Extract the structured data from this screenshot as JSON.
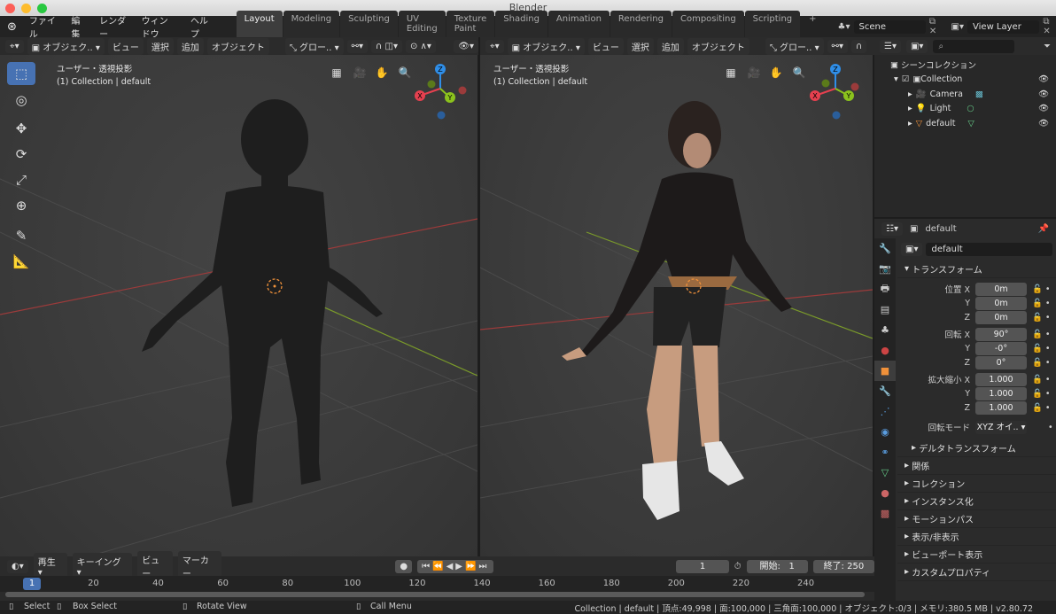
{
  "window": {
    "title": "Blender"
  },
  "topbar": {
    "menus": [
      "ファイル",
      "編集",
      "レンダー",
      "ウィンドウ",
      "ヘルプ"
    ],
    "workspaces": [
      "Layout",
      "Modeling",
      "Sculpting",
      "UV Editing",
      "Texture Paint",
      "Shading",
      "Animation",
      "Rendering",
      "Compositing",
      "Scripting"
    ],
    "add_tab": "+",
    "scene": "Scene",
    "view_layer": "View Layer"
  },
  "viewport_header": {
    "mode": "オブジェク..",
    "view": "ビュー",
    "select": "選択",
    "add": "追加",
    "object": "オブジェクト",
    "orientation": "グロー.."
  },
  "viewport_left": {
    "view_name": "ユーザー・透視投影",
    "collection_info": "(1) Collection | default"
  },
  "viewport_right": {
    "view_name": "ユーザー・透視投影",
    "collection_info": "(1) Collection | default"
  },
  "gizmo": {
    "x": "X",
    "y": "Y",
    "z": "Z"
  },
  "outliner": {
    "root": "シーンコレクション",
    "collection": "Collection",
    "items": [
      "Camera",
      "Light",
      "default"
    ]
  },
  "properties": {
    "object_name": "default",
    "data_name": "default",
    "transform_title": "トランスフォーム",
    "location": {
      "label": "位置 X",
      "x": "0m",
      "y": "0m",
      "z": "0m"
    },
    "rotation": {
      "label": "回転 X",
      "x": "90°",
      "y": "-0°",
      "z": "0°"
    },
    "scale": {
      "label": "拡大縮小 X",
      "x": "1.000",
      "y": "1.000",
      "z": "1.000"
    },
    "axis_y": "Y",
    "axis_z": "Z",
    "rotation_mode_label": "回転モード",
    "rotation_mode": "XYZ オイ..",
    "delta": "デルタトランスフォーム",
    "sections": [
      "関係",
      "コレクション",
      "インスタンス化",
      "モーションパス",
      "表示/非表示",
      "ビューポート表示",
      "カスタムプロパティ"
    ]
  },
  "timeline": {
    "playback": "再生",
    "keying": "キーイング",
    "view": "ビュー",
    "marker": "マーカー",
    "current_frame": "1",
    "start_label": "開始:",
    "start": "1",
    "end_label": "終了:",
    "end": "250",
    "ticks": [
      "20",
      "40",
      "60",
      "80",
      "100",
      "120",
      "140",
      "160",
      "180",
      "200",
      "220",
      "240"
    ],
    "playhead": "1"
  },
  "status": {
    "select": "Select",
    "box_select": "Box Select",
    "rotate_view": "Rotate View",
    "call_menu": "Call Menu",
    "info": "Collection | default | 頂点:49,998 | 面:100,000 | 三角面:100,000 | オブジェクト:0/3 | メモリ:380.5 MB | v2.80.72"
  },
  "colors": {
    "accent": "#4772b3",
    "x_axis": "#e5404f",
    "y_axis": "#8bc21d",
    "z_axis": "#2f8ee8",
    "object_orange": "#f0913a"
  }
}
